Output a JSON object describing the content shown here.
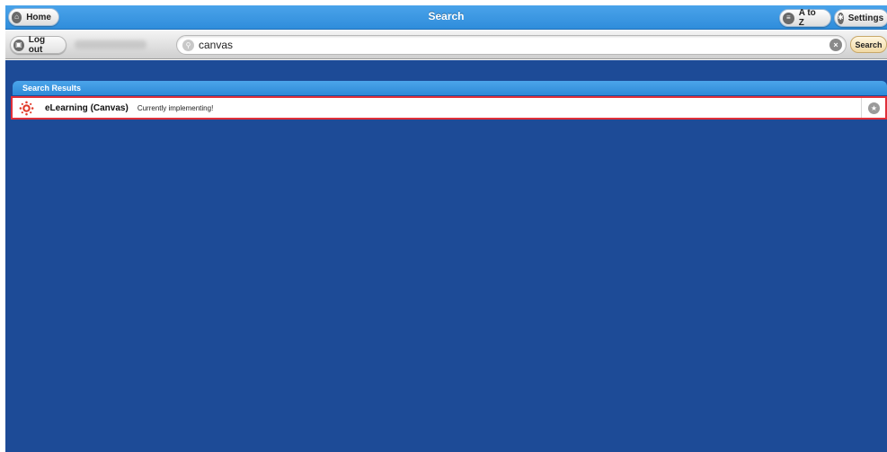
{
  "header": {
    "title": "Search",
    "home_label": "Home",
    "atoz_label": "A to Z",
    "settings_label": "Settings"
  },
  "toolbar": {
    "logout_label": "Log out",
    "search_value": "canvas",
    "search_button_label": "Search"
  },
  "results": {
    "header_label": "Search Results",
    "items": [
      {
        "name": "eLearning (Canvas)",
        "status": "Currently implementing!",
        "icon": "canvas-logo-icon"
      }
    ]
  },
  "colors": {
    "titlebar": "#3b97e2",
    "background": "#1d4b97",
    "highlight_border": "#e0303a",
    "canvas_red": "#e13b2b"
  }
}
